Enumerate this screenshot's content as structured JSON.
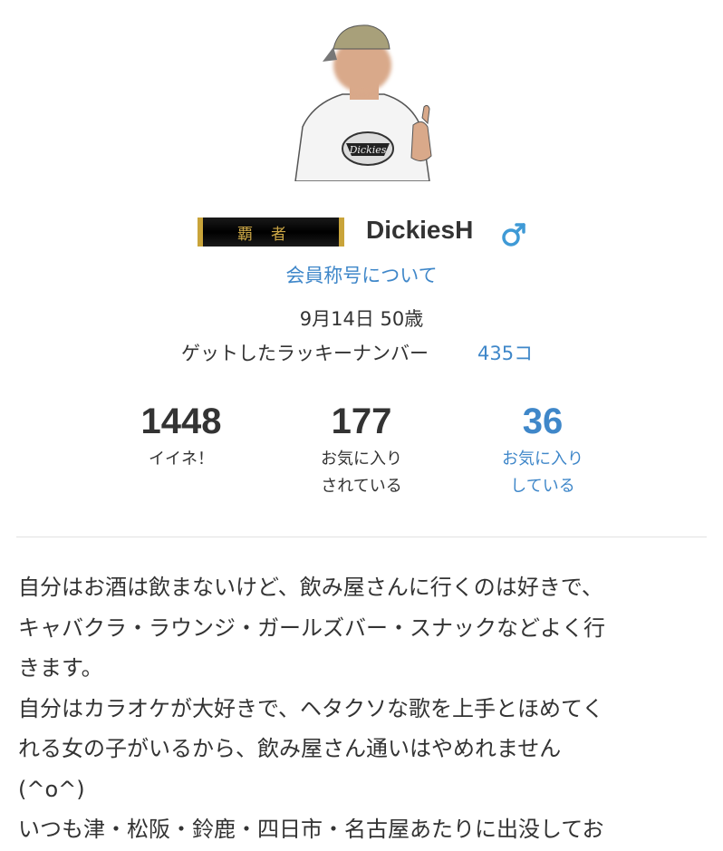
{
  "profile": {
    "title_badge": "覇者",
    "username": "DickiesH",
    "gender_icon": "male-symbol-icon",
    "title_link": "会員称号について",
    "birth_age": "9月14日 50歳",
    "lucky_label": "ゲットしたラッキーナンバー",
    "lucky_count": "435コ"
  },
  "stats": [
    {
      "value": "1448",
      "label_line1": "イイネ！",
      "label_line2": ""
    },
    {
      "value": "177",
      "label_line1": "お気に入り",
      "label_line2": "されている"
    },
    {
      "value": "36",
      "label_line1": "お気に入り",
      "label_line2": "している"
    }
  ],
  "bio_lines": [
    "自分はお酒は飲まないけど、飲み屋さんに行くのは好きで、",
    "キャバクラ・ラウンジ・ガールズバー・スナックなどよく行",
    "きます。",
    "自分はカラオケが大好きで、ヘタクソな歌を上手とほめてく",
    "れる女の子がいるから、飲み屋さん通いはやめれません",
    "(^o^)",
    "いつも津・松阪・鈴鹿・四日市・名古屋あたりに出没してお"
  ],
  "colors": {
    "link": "#3f87c9",
    "text": "#333333",
    "badge_gold": "#c9a43a"
  }
}
